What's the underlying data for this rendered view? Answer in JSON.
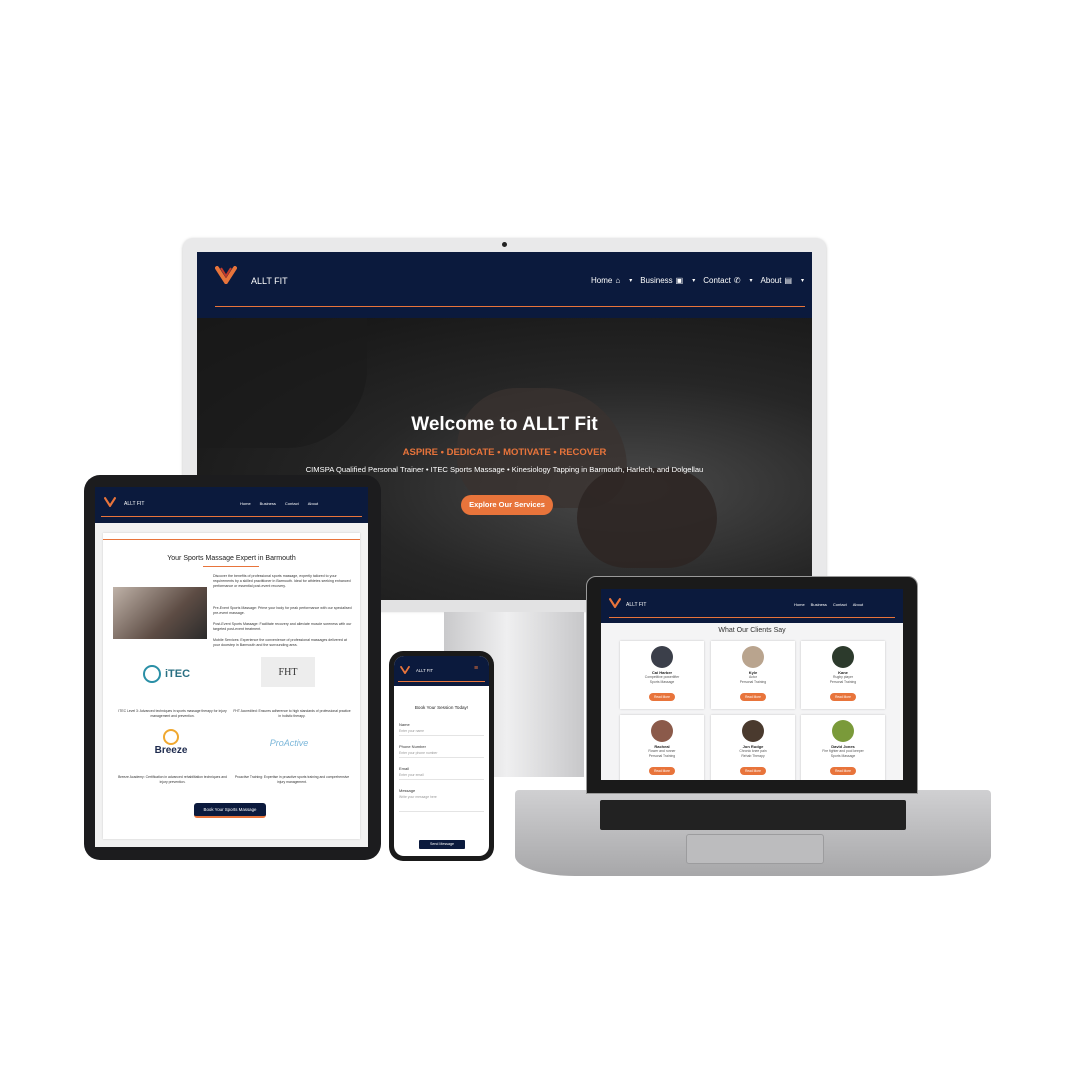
{
  "brand": {
    "name_desktop": "ALLT FIT",
    "name_small": "ALLT FIT",
    "accent": "#e8743b",
    "navy": "#0b1a3d"
  },
  "nav": [
    {
      "label": "Home",
      "icon": "home-icon"
    },
    {
      "label": "Business",
      "icon": "briefcase-icon"
    },
    {
      "label": "Contact",
      "icon": "phone-icon"
    },
    {
      "label": "About",
      "icon": "id-card-icon"
    }
  ],
  "hero": {
    "title": "Welcome to ALLT Fit",
    "tagline": "ASPIRE • DEDICATE • MOTIVATE • RECOVER",
    "subtitle": "CIMSPA Qualified Personal Trainer • ITEC Sports Massage • Kinesiology Tapping in Barmouth, Harlech, and Dolgellau",
    "cta": "Explore Our Services"
  },
  "tablet": {
    "heading": "Your Sports Massage Expert in Barmouth",
    "intro": "Discover the benefits of professional sports massage, expertly tailored to your requirements by a skilled practitioner in Barmouth. Ideal for athletes seeking enhanced performance or essential post-event recovery.",
    "pre_event": "Pre-Event Sports Massage: Prime your body for peak performance with our specialised pre-event massage.",
    "post_event": "Post-Event Sports Massage: Facilitate recovery and alleviate muscle soreness with our targeted post-event treatment.",
    "mobile": "Mobile Services: Experience the convenience of professional massages delivered at your doorstep in Barmouth and the surrounding area.",
    "logos": [
      {
        "name": "iTEC",
        "caption": "ITEC Level 3: Advanced techniques in sports massage therapy for injury management and prevention."
      },
      {
        "name": "FHT",
        "caption": "FHT Accredited: Ensures adherence to high standards of professional practice in holistic therapy."
      },
      {
        "name": "Breeze",
        "caption": "Breeze Academy: Certification in advanced rehabilitation techniques and injury prevention."
      },
      {
        "name": "ProActive",
        "caption": "Proactive Training: Expertise in proactive sports training and comprehensive injury management."
      }
    ],
    "cta": "Book Your Sports Massage"
  },
  "phone": {
    "heading": "Book Your Session Today!",
    "fields": [
      {
        "label": "Name",
        "placeholder": "Enter your name"
      },
      {
        "label": "Phone Number",
        "placeholder": "Enter your phone number"
      },
      {
        "label": "Email",
        "placeholder": "Enter your email"
      },
      {
        "label": "Message",
        "placeholder": "Write your message here"
      }
    ],
    "submit": "Send Message"
  },
  "laptop": {
    "heading": "What Our Clients Say",
    "read_more": "Read More",
    "testimonials": [
      {
        "name": "Cai Harber",
        "line1": "Competitive powerlifter",
        "line2": "Sports Massage",
        "color": "#3b3f4a"
      },
      {
        "name": "Kyle",
        "line1": "Actor",
        "line2": "Personal Training",
        "color": "#b9a48e"
      },
      {
        "name": "Kane",
        "line1": "Rugby player",
        "line2": "Personal Training",
        "color": "#2c3a2c"
      },
      {
        "name": "Racheal",
        "line1": "Rower and runner",
        "line2": "Personal Training",
        "color": "#8b5a4a"
      },
      {
        "name": "Jon Rudge",
        "line1": "Chronic knee pain",
        "line2": "Rehab Therapy",
        "color": "#4a3a2e"
      },
      {
        "name": "David Jones",
        "line1": "Fire fighter and pool keeper",
        "line2": "Sports Massage",
        "color": "#7a9a3a"
      }
    ]
  }
}
